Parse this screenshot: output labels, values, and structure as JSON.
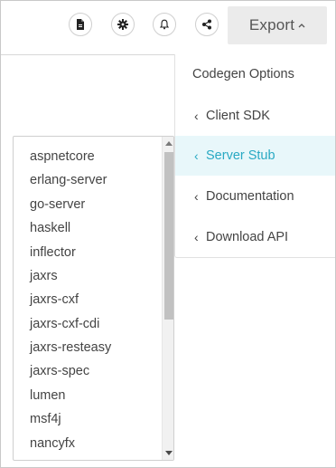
{
  "toolbar": {
    "icons": [
      "file-icon",
      "gear-icon",
      "bell-icon",
      "share-icon"
    ],
    "export_label": "Export"
  },
  "menu": {
    "header": "Codegen Options",
    "items": [
      {
        "label": "Client SDK",
        "active": false
      },
      {
        "label": "Server Stub",
        "active": true
      },
      {
        "label": "Documentation",
        "active": false
      },
      {
        "label": "Download API",
        "active": false
      }
    ]
  },
  "list": {
    "items": [
      "aspnetcore",
      "erlang-server",
      "go-server",
      "haskell",
      "inflector",
      "jaxrs",
      "jaxrs-cxf",
      "jaxrs-cxf-cdi",
      "jaxrs-resteasy",
      "jaxrs-spec",
      "lumen",
      "msf4j",
      "nancyfx"
    ]
  },
  "colors": {
    "accent": "#29a9c3",
    "active_bg": "#e8f7fa",
    "export_bg": "#ebebeb"
  }
}
